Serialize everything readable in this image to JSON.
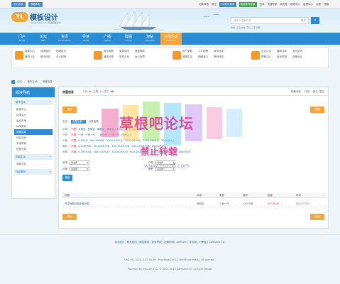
{
  "topbar": {
    "left": [
      "设为首页",
      "收藏本站"
    ],
    "right": [
      "切换风格",
      "退出",
      "QQ账号登录",
      "微信账号登录",
      "登录",
      "快捷导航",
      "我的圈",
      "管理中心",
      "管理中心",
      "设置",
      "提醒"
    ]
  },
  "header": {
    "logo_mark": "YL",
    "logo_name": "模板设计",
    "logo_sub": "www.ylmb.com 专注模板设计",
    "search_placeholder": "请输入搜索内容",
    "search_scope": "帖子",
    "search_button": "⌕",
    "hot": "热搜: 活动 交友 手机 二手 招聘"
  },
  "nav": [
    {
      "cn": "门户",
      "en": "Portal"
    },
    {
      "cn": "论坛",
      "en": "BBS"
    },
    {
      "cn": "资讯",
      "en": "Information"
    },
    {
      "cn": "导读",
      "en": "Guide"
    },
    {
      "cn": "广播",
      "en": "Follow"
    },
    {
      "cn": "群组",
      "en": "Group"
    },
    {
      "cn": "淘帖",
      "en": "Collection"
    },
    {
      "cn": "分类信息",
      "en": "Classified"
    }
  ],
  "subnav": [
    {
      "links": [
        "新闻中心",
        "休闲娱乐",
        "吃喝玩乐",
        "情感八卦",
        "都市传说",
        "开心购物"
      ]
    },
    {
      "links": [
        "育乐观照",
        "旅游休闲",
        "美食美味",
        "情感分享",
        "城市互动",
        "女人世界"
      ]
    },
    {
      "links": [
        "房产家居",
        "人才招聘",
        "城市信息",
        "健康生活",
        "晒晒宝贝",
        "数码科技"
      ]
    },
    {
      "links": [
        "社区公告",
        "最新活动",
        "会员交流",
        "帮助中心",
        "投诉举报",
        "风格设计"
      ]
    }
  ],
  "crumb": [
    "论坛",
    "城市互动",
    "房屋信息"
  ],
  "sidebar": {
    "title": "版块导航",
    "sections": [
      {
        "name": "城市互动",
        "links": [
          "影视中心",
          "动漫中心",
          "运动天地",
          "休闲风尚",
          "房屋信息",
          "社区活动",
          "本地商家",
          "信息分类"
        ],
        "active": 4
      },
      {
        "name": "同城生活",
        "links": [
          "同城交友"
        ]
      },
      {
        "name": "社区服务",
        "links": []
      }
    ]
  },
  "main": {
    "title": "房屋信息",
    "stats_a": "今日: ",
    "stats_today": "0",
    "stats_b": " | 主题: 4 | 排名: ",
    "stats_rank": "16",
    "right_links": [
      "收藏本版",
      "订阅",
      "版主: 暂无"
    ],
    "post_button": "发帖",
    "return_button": "返回",
    "all_label": "全部",
    "chip": "房屋出租",
    "chip_count": "1",
    "type_label": "分类信息",
    "filters": [
      {
        "label": "区域",
        "options": [
          "不限",
          "东城区",
          "西城区",
          "朝阳区",
          "海淀区",
          "丰台区",
          "石景山区",
          "通州区"
        ]
      },
      {
        "label": "户型",
        "options": [
          "不限",
          "一室",
          "一室一厅",
          "二室一厅",
          "三室一厅",
          "四室以上"
        ]
      },
      {
        "label": "价格",
        "options": [
          "不限",
          "0-500元",
          "500-1000元",
          "1000-1500元",
          "1500-2000元",
          "2000-3000元",
          "3000元以上"
        ]
      },
      {
        "label": "面积",
        "options": [
          "不限",
          "0-50平方米",
          "50-100平方米",
          "100-150平方米",
          "150-200平方米",
          "200平方米以上"
        ]
      },
      {
        "label": "其他",
        "options": [
          "不限",
          "0-100元/月",
          "100-300元/月",
          "300-600元/月",
          "600-1000元/月",
          "1000-2000元/月",
          "2000-3000元/月"
        ]
      }
    ],
    "selects": [
      {
        "label": "区域",
        "value": "请选择"
      },
      {
        "label": "户型",
        "value": "请选择"
      },
      {
        "label": "价格",
        "value": "请选择"
      },
      {
        "label": "面积",
        "value": "请选择"
      }
    ],
    "search_button": "搜索",
    "table_headers": [
      "标题",
      "区域",
      "类型",
      "面积",
      "租金",
      "时间"
    ],
    "rows": [
      {
        "title": "市区房屋出租出租信息",
        "area": "西城区",
        "type": "三室一厅",
        "size": "120 平米",
        "price": "200 元/月",
        "time": "2014-3-12"
      }
    ],
    "watermark": [
      "草根吧论坛",
      "禁止转载",
      "www.cgzz8.com"
    ]
  },
  "footer": {
    "links": "站点统计 | 联系我们 | 网站服务 | 投诉举报 | 友情申请 | Archiver | 手机版 | 小黑屋 | Comsenz Inc.",
    "time": "GMT+8, 2015-5-15 16:36 , Processed in 0.128498 second(s), 36 queries .",
    "powered": "Powered by Discuz! X3.2 © 2001-2013 Comsenz Inc. & Style Design"
  },
  "colors": {
    "primary": "#2a8dd4",
    "accent": "#f7a43c",
    "link": "#2b6aa0",
    "alert": "#e22233"
  }
}
